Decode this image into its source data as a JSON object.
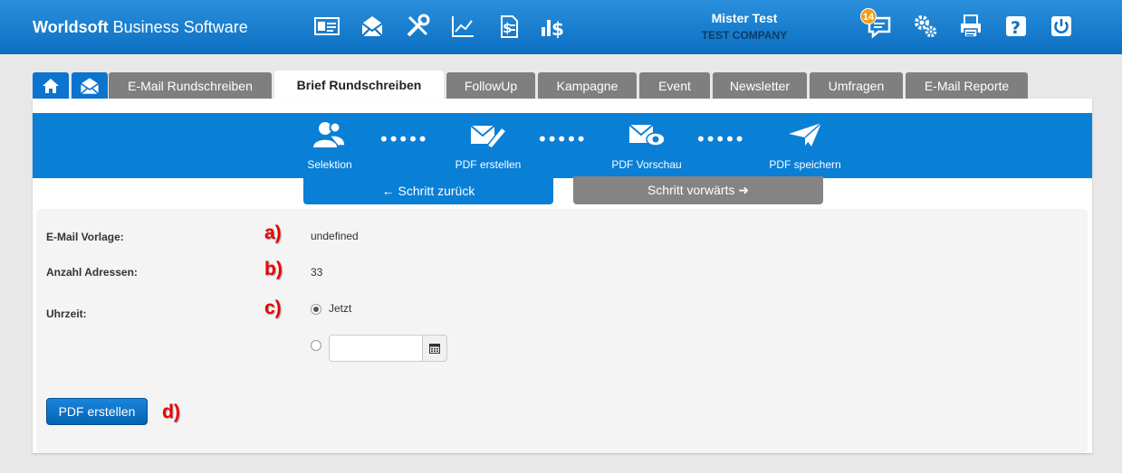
{
  "header": {
    "brand_bold": "Worldsoft",
    "brand_rest": " Business Software",
    "user_name": "Mister Test",
    "company": "TEST COMPANY",
    "notification_count": "14",
    "icons": [
      "contact-card-icon",
      "mail-campaign-icon",
      "tools-icon",
      "chart-icon",
      "invoice-icon",
      "revenue-icon",
      "chat-icon",
      "settings-gears-icon",
      "print-icon",
      "help-icon",
      "power-icon"
    ]
  },
  "tabs": [
    {
      "label": "E-Mail Rundschreiben"
    },
    {
      "label": "Brief Rundschreiben",
      "active": true
    },
    {
      "label": "FollowUp"
    },
    {
      "label": "Kampagne"
    },
    {
      "label": "Event"
    },
    {
      "label": "Newsletter"
    },
    {
      "label": "Umfragen"
    },
    {
      "label": "E-Mail Reporte"
    }
  ],
  "steps": [
    {
      "label": "Selektion",
      "icon": "users-icon"
    },
    {
      "label": "PDF erstellen",
      "icon": "mail-edit-icon"
    },
    {
      "label": "PDF Vorschau",
      "icon": "mail-eye-icon"
    },
    {
      "label": "PDF speichern",
      "icon": "paper-plane-icon"
    }
  ],
  "nav": {
    "back": "← Schritt zurück",
    "forward": "Schritt vorwärts ➜"
  },
  "form": {
    "template_label": "E-Mail Vorlage:",
    "template_value": "undefined",
    "addresses_label": "Anzahl Adressen:",
    "addresses_value": "33",
    "time_label": "Uhrzeit:",
    "time_now": "Jetzt",
    "date_value": "",
    "submit": "PDF erstellen"
  },
  "markers": [
    "a)",
    "b)",
    "c)",
    "d)"
  ],
  "colors": {
    "primary": "#0a7fd6",
    "tab_inactive": "#7f7f7f",
    "marker": "#ee0000",
    "badge": "#f39c12"
  }
}
